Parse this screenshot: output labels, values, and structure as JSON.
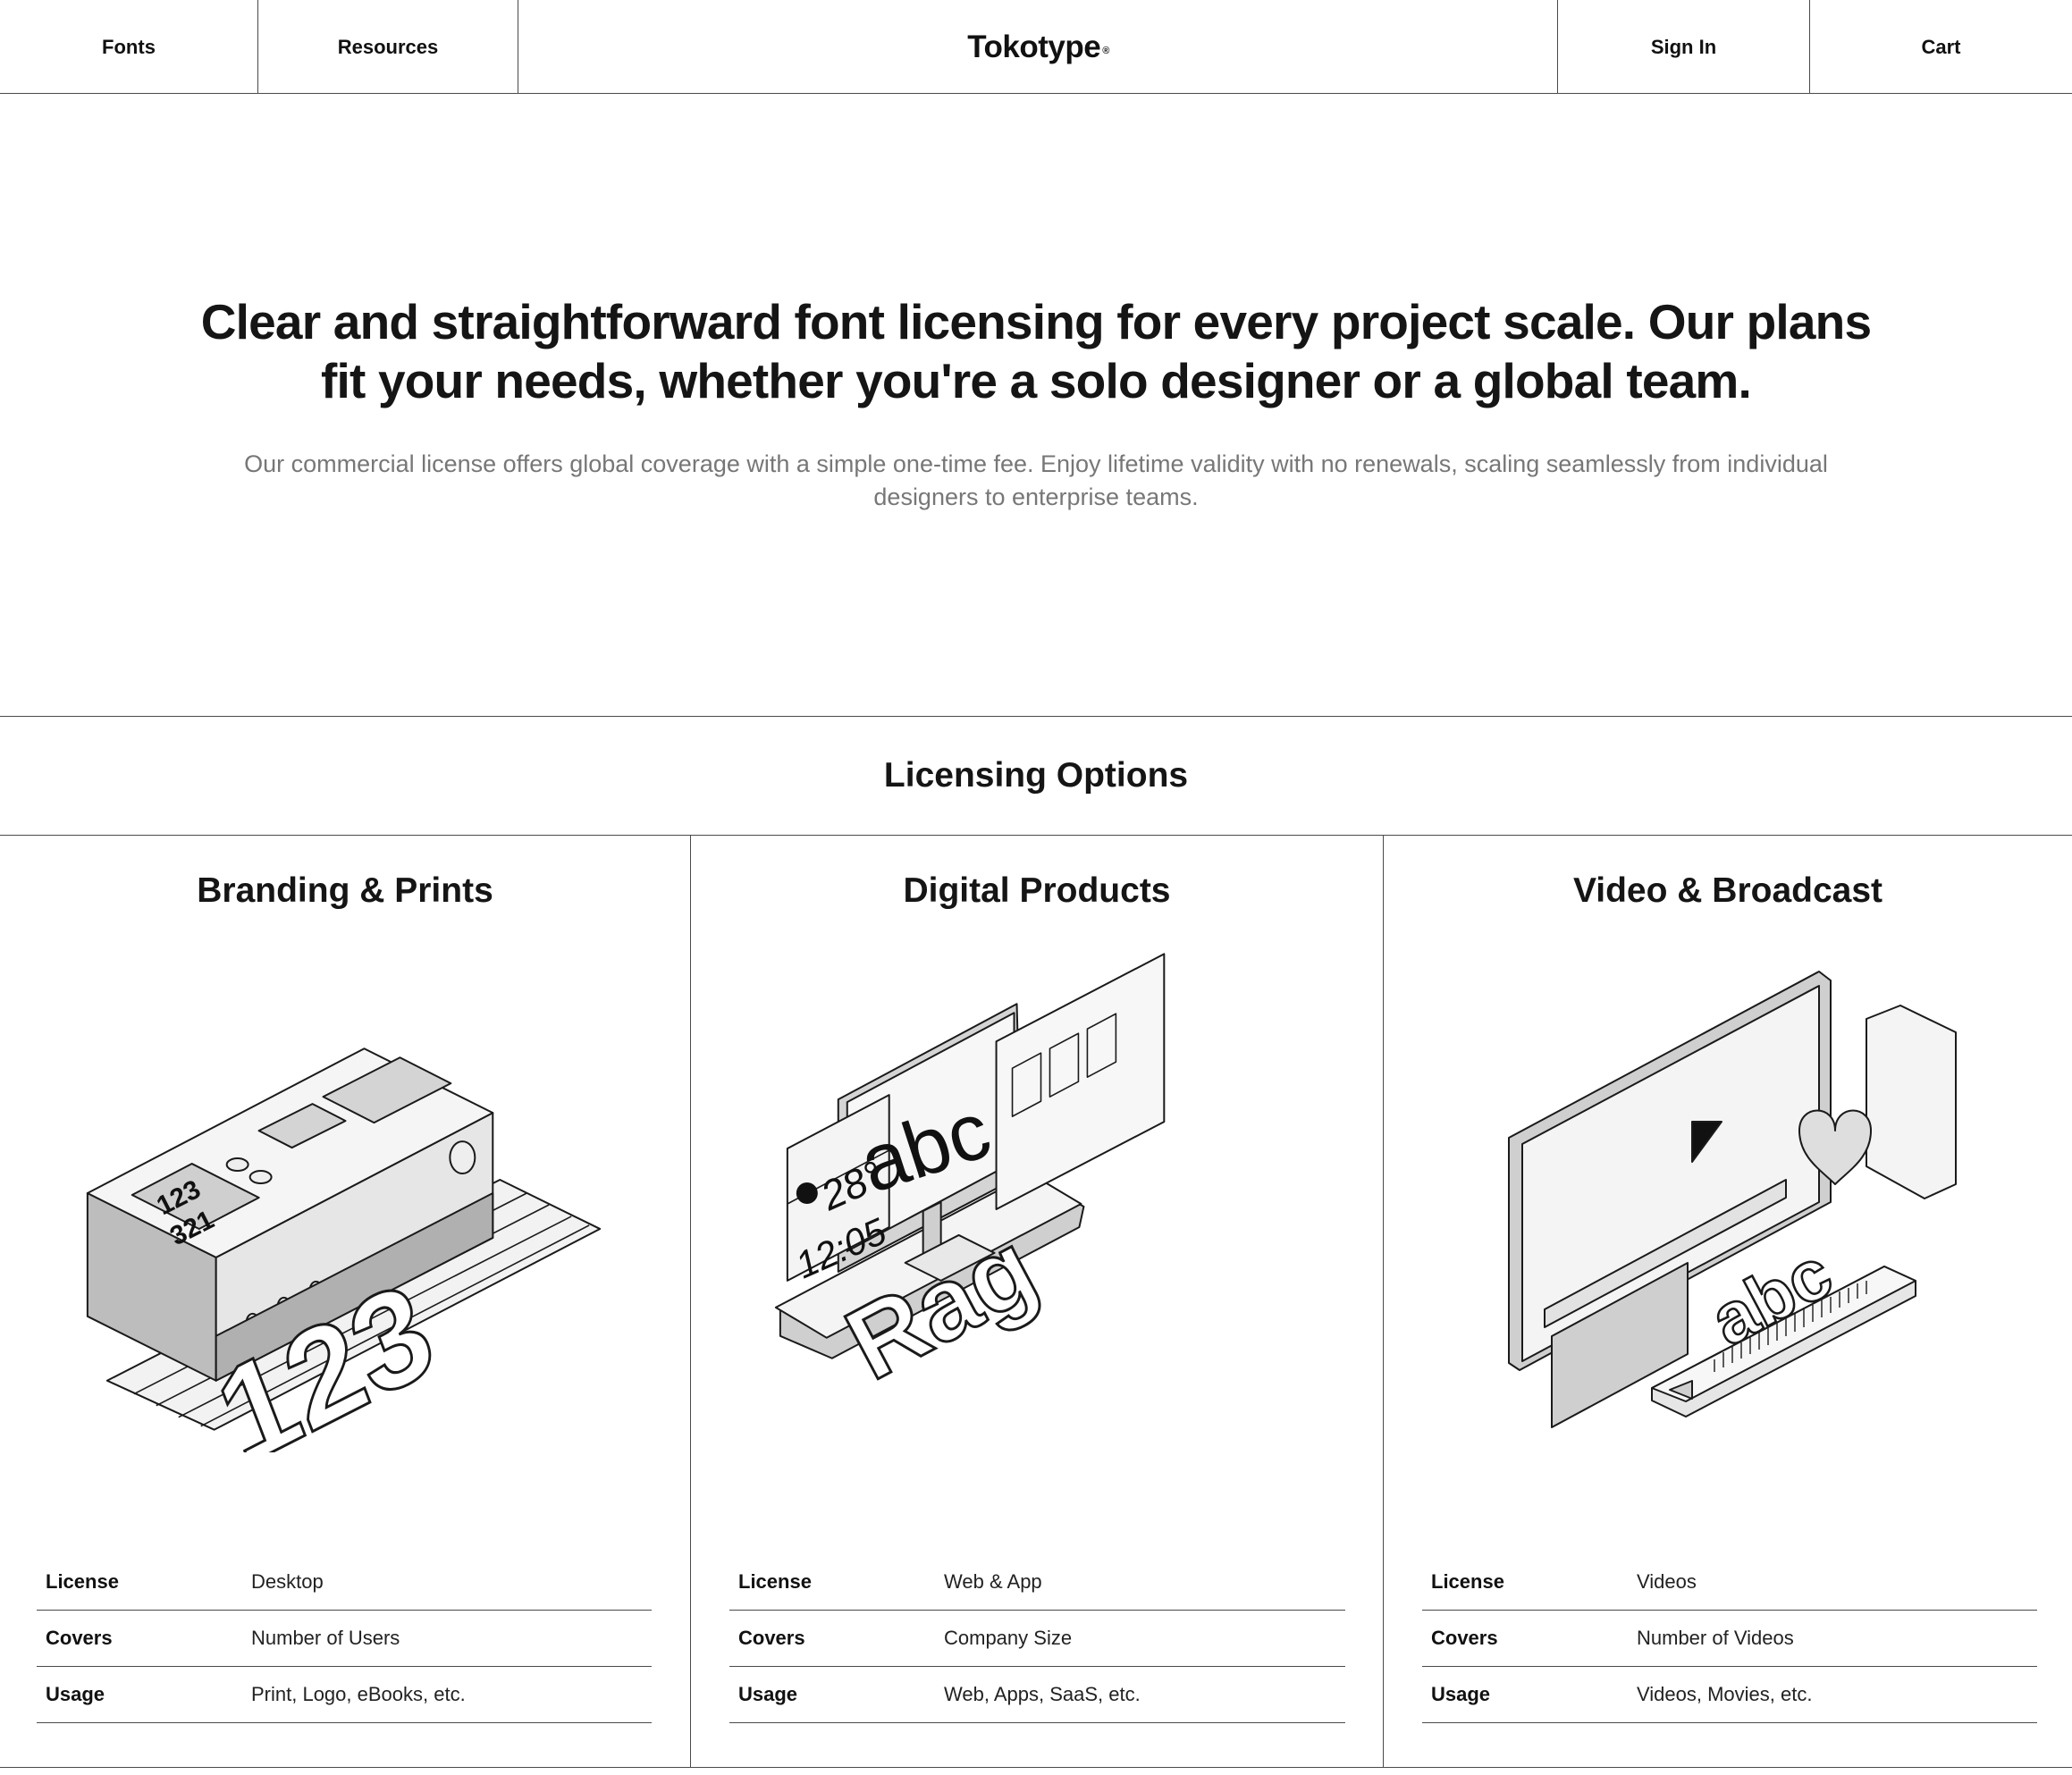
{
  "nav": {
    "fonts": "Fonts",
    "resources": "Resources",
    "logo": "Tokotype",
    "logo_mark": "®",
    "sign_in": "Sign In",
    "cart": "Cart"
  },
  "hero": {
    "headline": "Clear and straightforward font licensing for every project scale. Our plans fit your needs, whether you're a solo designer or a global team.",
    "subtext": "Our commercial license offers global coverage with a simple one-time fee. Enjoy lifetime validity with no renewals, scaling seamlessly from individual designers to enterprise teams."
  },
  "section": {
    "title": "Licensing Options"
  },
  "cards": [
    {
      "title": "Branding & Prints",
      "illustration": "printer-icon",
      "illustration_text": [
        "123",
        "321",
        "123"
      ],
      "rows": [
        {
          "key": "License",
          "value": "Desktop"
        },
        {
          "key": "Covers",
          "value": "Number of Users"
        },
        {
          "key": "Usage",
          "value": "Print, Logo, eBooks, etc."
        }
      ]
    },
    {
      "title": "Digital Products",
      "illustration": "devices-icon",
      "illustration_text": [
        "abc",
        "28°",
        "12:05",
        "Rag"
      ],
      "rows": [
        {
          "key": "License",
          "value": "Web & App"
        },
        {
          "key": "Covers",
          "value": "Company Size"
        },
        {
          "key": "Usage",
          "value": "Web, Apps, SaaS, etc."
        }
      ]
    },
    {
      "title": "Video & Broadcast",
      "illustration": "video-player-icon",
      "illustration_text": [
        "abc"
      ],
      "rows": [
        {
          "key": "License",
          "value": "Videos"
        },
        {
          "key": "Covers",
          "value": "Number of Videos"
        },
        {
          "key": "Usage",
          "value": "Videos, Movies, etc."
        }
      ]
    }
  ],
  "colors": {
    "text": "#111111",
    "muted": "#777777",
    "line": "#4a4a4a",
    "illus_fill": "#d4d4d4"
  }
}
